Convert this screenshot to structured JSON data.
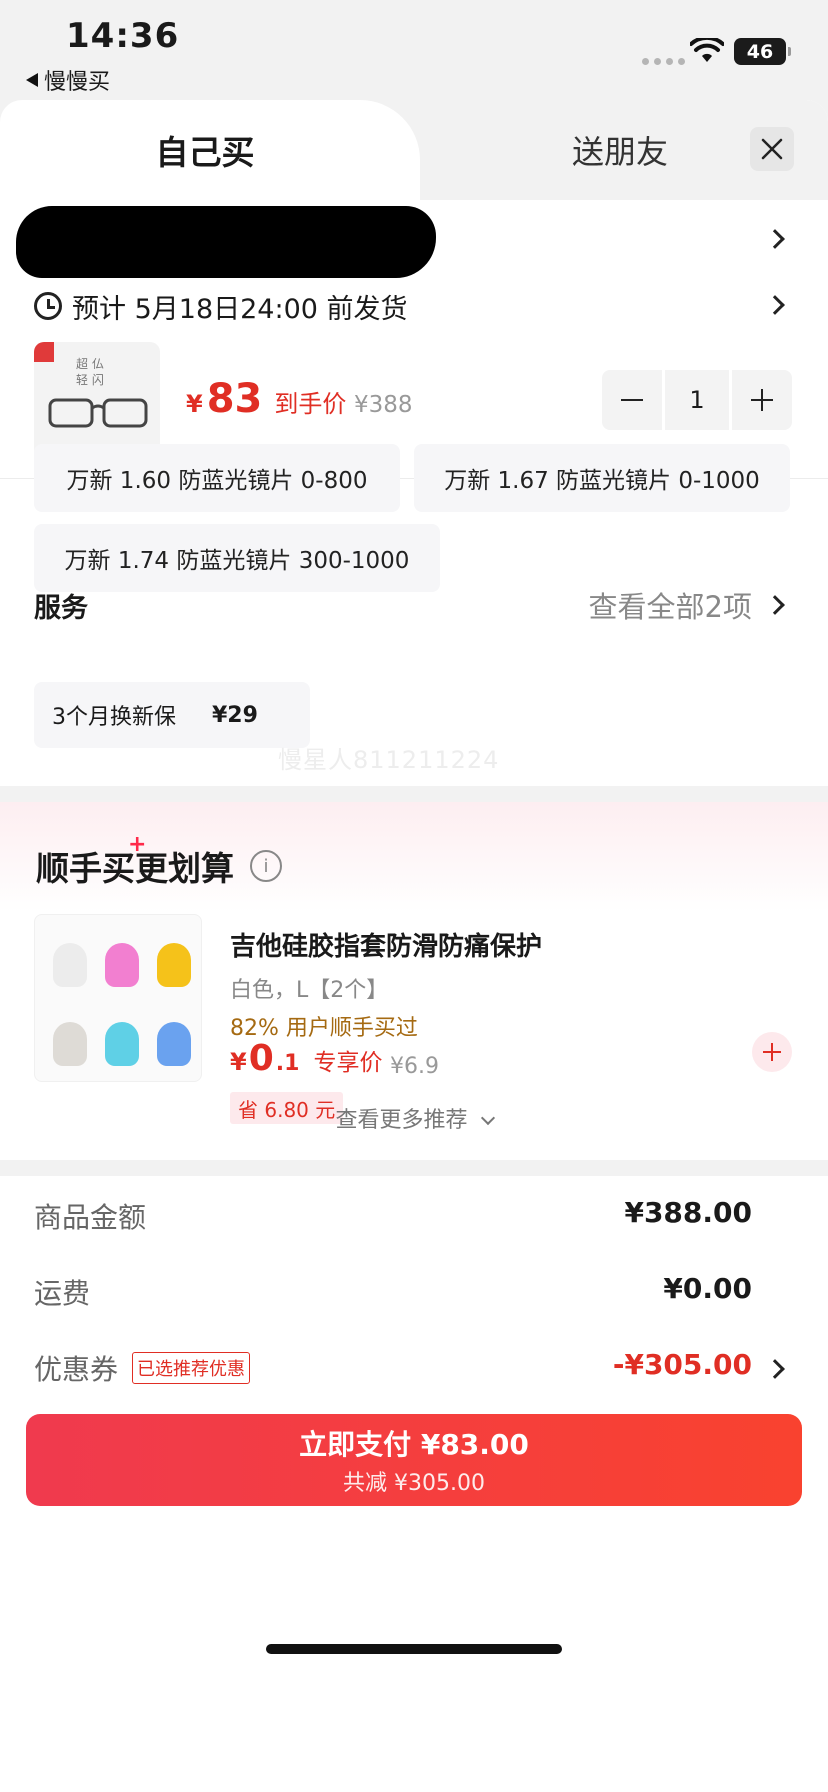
{
  "status_bar": {
    "time": "14:36",
    "back_label": "慢慢买",
    "battery": "46"
  },
  "tabs": {
    "self": "自己买",
    "friend": "送朋友"
  },
  "shipping": {
    "estimate": "预计 5月18日24:00 前发货"
  },
  "product": {
    "image_text": "超 仏\n轻 闪",
    "price_currency": "¥",
    "price": "83",
    "price_label": "到手价",
    "original_price": "¥388",
    "quantity": "1"
  },
  "lens_options": [
    "万新 1.60 防蓝光镜片 0-800",
    "万新 1.67 防蓝光镜片 0-1000",
    "万新 1.74 防蓝光镜片 300-1000"
  ],
  "service": {
    "title": "服务",
    "more": "查看全部2项",
    "chip_name": "3个月换新保",
    "chip_price": "¥29"
  },
  "watermark": "慢星人811211224",
  "addon": {
    "title": "顺手买更划算",
    "spark": "+",
    "name": "吉他硅胶指套防滑防痛保护",
    "spec": "白色，L【2个】",
    "percent": "82% 用户顺手买过",
    "price_currency": "¥",
    "price_int": "0",
    "price_dec": ".1",
    "price_label": "专享价",
    "original_price": "¥6.9",
    "save": "省 6.80 元",
    "see_more": "查看更多推荐",
    "swatch_colors": [
      "#ececec",
      "#f27fd0",
      "#f5c21a",
      "#dedbd6",
      "#5fd0e6",
      "#6aa2ef"
    ]
  },
  "summary": {
    "goods_label": "商品金额",
    "goods_value": "¥388.00",
    "freight_label": "运费",
    "freight_value": "¥0.00",
    "coupon_label": "优惠券",
    "coupon_tag": "已选推荐优惠",
    "coupon_value": "-¥305.00"
  },
  "pay": {
    "main": "立即支付 ¥83.00",
    "sub": "共减 ¥305.00"
  },
  "colors": {
    "accent": "#e02e24",
    "pay_start": "#f03a4e",
    "pay_end": "#f9422f"
  }
}
